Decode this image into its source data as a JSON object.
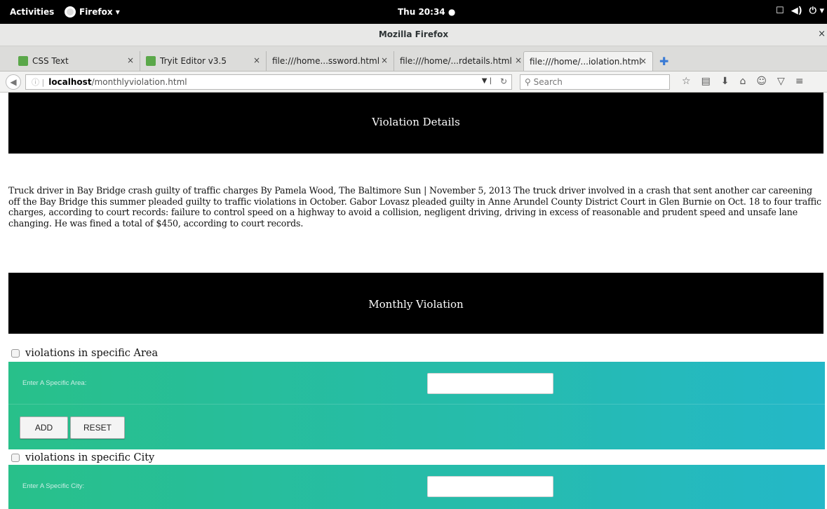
{
  "topbar": {
    "activities": "Activities",
    "app_menu": "Firefox ▾",
    "clock": "Thu 20:34 ●",
    "tray_icons": [
      "window-icon",
      "volume-icon",
      "power-icon"
    ]
  },
  "window": {
    "title": "Mozilla Firefox",
    "close": "×"
  },
  "tabs": [
    {
      "label": "CSS Text",
      "close": "×"
    },
    {
      "label": "Tryit Editor v3.5",
      "close": "×"
    },
    {
      "label": "file:///home...ssword.html",
      "close": "×"
    },
    {
      "label": "file:///home/...rdetails.html",
      "close": "×"
    },
    {
      "label": "file:///home/...iolation.html",
      "close": "×"
    }
  ],
  "nav": {
    "url_host": "localhost",
    "url_path": "/monthlyviolation.html",
    "search_placeholder": "Search"
  },
  "page": {
    "banner1": "Violation Details",
    "article": "Truck driver in Bay Bridge crash guilty of traffic charges By Pamela Wood, The Baltimore Sun | November 5, 2013 The truck driver involved in a crash that sent another car careening off the Bay Bridge this summer pleaded guilty to traffic violations in October. Gabor Lovasz pleaded guilty in Anne Arundel County District Court in Glen Burnie on Oct. 18 to four traffic charges, according to court records: failure to control speed on a highway to avoid a collision, negligent driving, driving in excess of reasonable and prudent speed and unsafe lane changing. He was fined a total of $450, according to court records.",
    "banner2": "Monthly Violation",
    "area": {
      "checkbox_label": "violations in specific Area",
      "field_label": "Enter A Specific Area:",
      "field_value": "",
      "add_label": "ADD",
      "reset_label": "RESET"
    },
    "city": {
      "checkbox_label": "violations in specific City",
      "field_label": "Enter A Specific City:",
      "field_value": ""
    }
  }
}
